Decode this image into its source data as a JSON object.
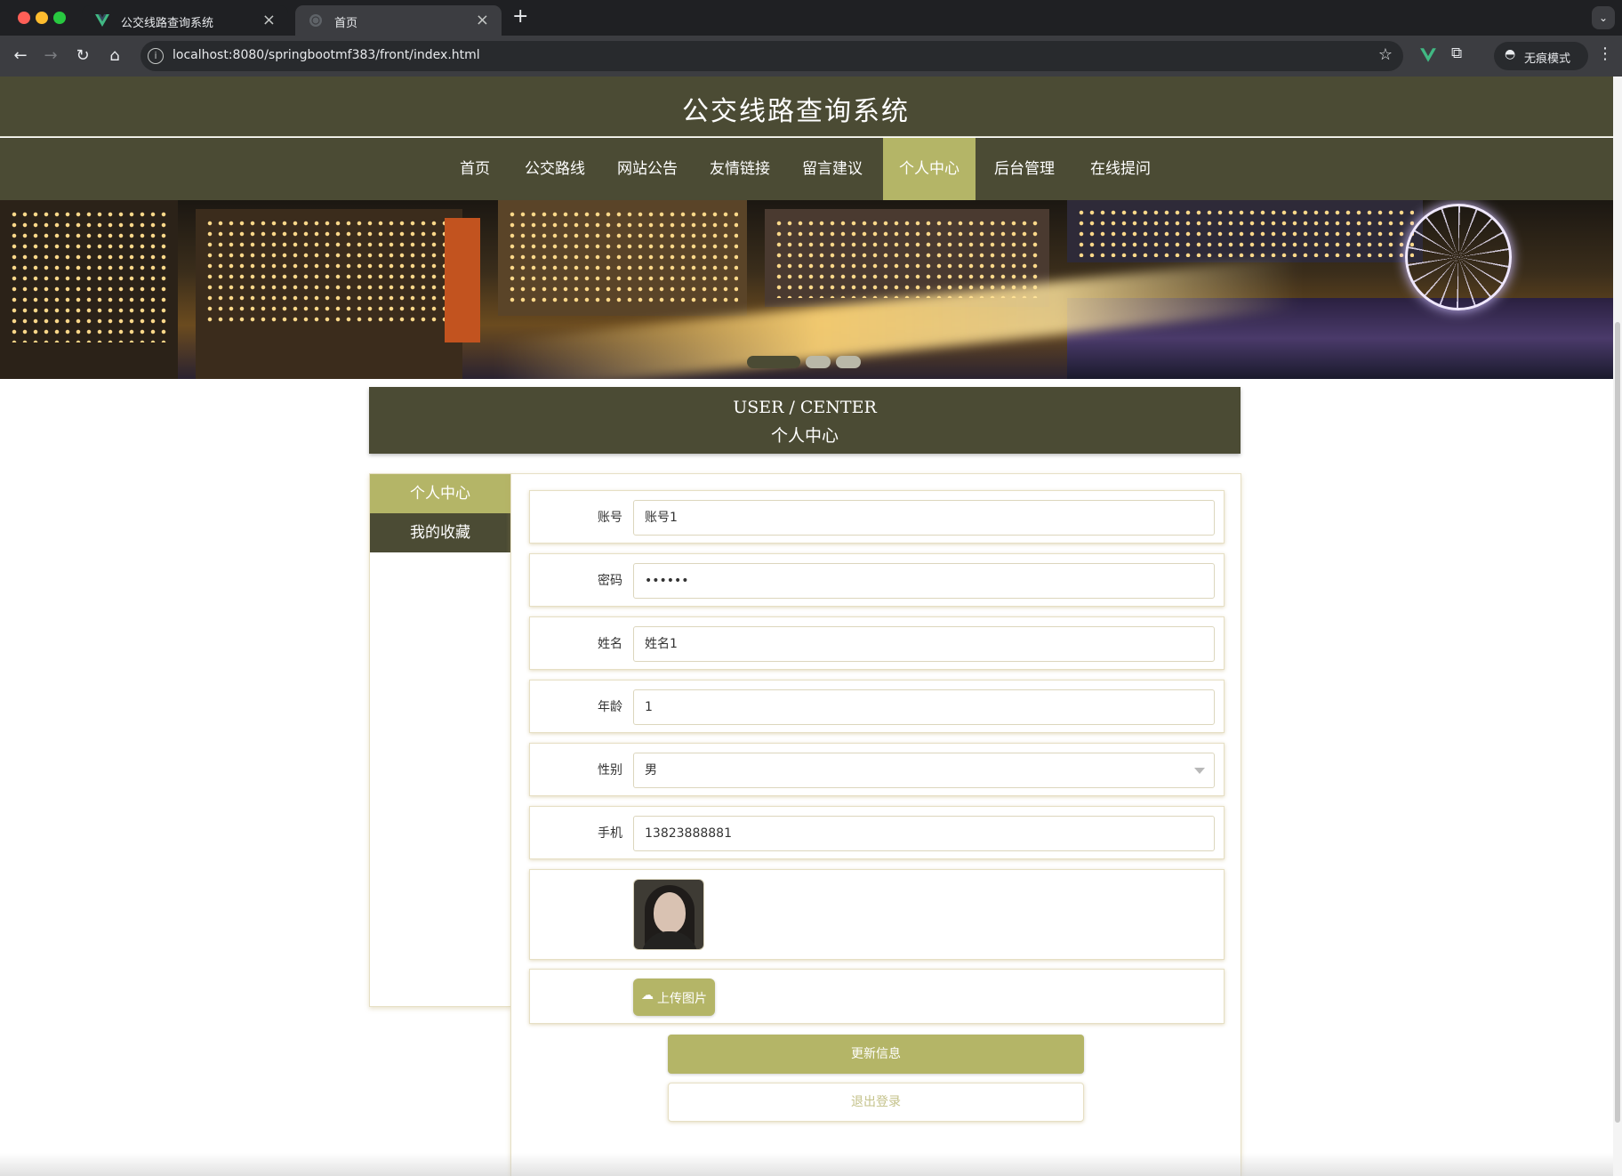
{
  "browser": {
    "tabs": [
      {
        "title": "公交线路查询系统",
        "active": true
      },
      {
        "title": "首页",
        "active": false
      }
    ],
    "url": "localhost:8080/springbootmf383/front/index.html",
    "incognito_label": "无痕模式",
    "icons": {
      "back": "arrow-left-icon",
      "forward": "arrow-right-icon",
      "reload": "reload-icon",
      "home": "home-icon",
      "bookmark": "star-icon",
      "vue_devtools": "vue-icon",
      "extensions": "puzzle-icon",
      "menu": "kebab-icon"
    }
  },
  "site": {
    "title": "公交线路查询系统",
    "nav": [
      {
        "label": "首页",
        "active": false
      },
      {
        "label": "公交路线",
        "active": false
      },
      {
        "label": "网站公告",
        "active": false
      },
      {
        "label": "友情链接",
        "active": false
      },
      {
        "label": "留言建议",
        "active": false
      },
      {
        "label": "个人中心",
        "active": true
      },
      {
        "label": "后台管理",
        "active": false
      },
      {
        "label": "在线提问",
        "active": false
      }
    ]
  },
  "banner": {
    "slide_count": 3,
    "active_slide": 1
  },
  "user_center": {
    "title_en": "USER / CENTER",
    "title_zh": "个人中心"
  },
  "sidebar": {
    "items": [
      {
        "label": "个人中心",
        "active": true
      },
      {
        "label": "我的收藏",
        "active": false
      }
    ]
  },
  "form": {
    "fields": [
      {
        "label": "账号",
        "value": "账号1",
        "type": "text"
      },
      {
        "label": "密码",
        "value": "••••••",
        "type": "password"
      },
      {
        "label": "姓名",
        "value": "姓名1",
        "type": "text"
      },
      {
        "label": "年龄",
        "value": "1",
        "type": "text"
      },
      {
        "label": "性别",
        "value": "男",
        "type": "select"
      },
      {
        "label": "手机",
        "value": "13823888881",
        "type": "text"
      }
    ],
    "upload_label": "上传图片",
    "update_label": "更新信息",
    "logout_label": "退出登录"
  },
  "colors": {
    "dark_olive": "#4b4b34",
    "accent": "#b4b567",
    "logout_text": "#c4c28a"
  }
}
